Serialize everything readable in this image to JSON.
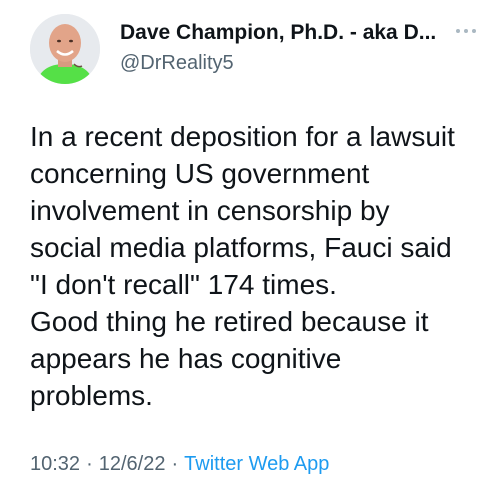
{
  "tweet": {
    "author": {
      "display_name": "Dave Champion, Ph.D. - aka D...",
      "handle": "@DrReality5",
      "avatar_icon": "avatar-photo",
      "more_icon": "more-options-icon"
    },
    "text_lines": [
      "In a recent deposition for a lawsuit",
      "concerning US government",
      "involvement in censorship by",
      "social media platforms, Fauci said",
      "\"I don't recall\" 174 times.",
      "Good thing he retired because it",
      "appears he has cognitive",
      "problems."
    ],
    "meta": {
      "time": "10:32",
      "date": "12/6/22",
      "separator": "·",
      "source": "Twitter Web App"
    }
  },
  "colors": {
    "text": "#0f1419",
    "secondary": "#536471",
    "link": "#1d9bf0",
    "avatar_shirt": "#55e047"
  }
}
